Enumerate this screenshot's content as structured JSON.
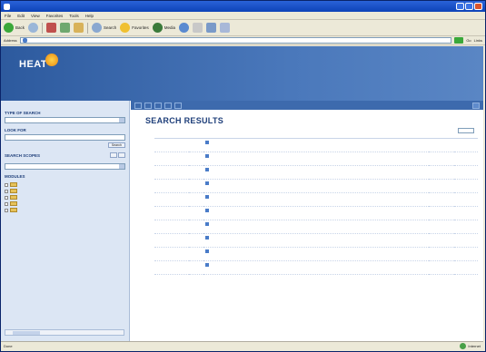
{
  "window": {
    "title": "",
    "menu": [
      "File",
      "Edit",
      "View",
      "Favorites",
      "Tools",
      "Help"
    ]
  },
  "toolbar": {
    "back_label": "Back",
    "search_label": "Search",
    "favorites_label": "Favorites",
    "media_label": "Media"
  },
  "address": {
    "label": "Address",
    "value": "",
    "go_label": "Go",
    "links_label": "Links"
  },
  "banner": {
    "logo": "HEAT",
    "subtitle": ""
  },
  "sidebar": {
    "type_label": "TYPE OF SEARCH",
    "type_value": "",
    "look_label": "LOOK FOR",
    "look_value": "",
    "search_button": "Search",
    "scope_label": "SEARCH SCOPES",
    "scope_btn_a": "",
    "scope_btn_b": "",
    "sub_label": "",
    "sub_value": "",
    "modules_label": "MODULES",
    "tree": [
      {
        "label": "",
        "selected": true
      },
      {
        "label": ""
      },
      {
        "label": ""
      },
      {
        "label": ""
      },
      {
        "label": ""
      }
    ]
  },
  "tabs": {
    "items": [
      "",
      "",
      "",
      "",
      ""
    ],
    "right": ""
  },
  "results": {
    "heading": "SEARCH RESULTS",
    "count_text": "",
    "perpage_label": "",
    "columns": {
      "id": "",
      "rank": "",
      "description": "",
      "type": "",
      "action": ""
    },
    "rows": [
      {
        "id": "",
        "rank": "",
        "desc": "",
        "action": ""
      },
      {
        "id": "",
        "rank": "",
        "desc": "",
        "action": ""
      },
      {
        "id": "",
        "rank": "",
        "desc": "",
        "action": ""
      },
      {
        "id": "",
        "rank": "",
        "desc": "",
        "action": ""
      },
      {
        "id": "",
        "rank": "",
        "desc": "",
        "action": ""
      },
      {
        "id": "",
        "rank": "",
        "desc": "",
        "action": ""
      },
      {
        "id": "",
        "rank": "",
        "desc": "",
        "action": ""
      },
      {
        "id": "",
        "rank": "",
        "desc": "",
        "action": ""
      },
      {
        "id": "",
        "rank": "",
        "desc": "",
        "action": ""
      },
      {
        "id": "",
        "rank": "",
        "desc": "",
        "action": ""
      }
    ],
    "pager": ""
  },
  "status": {
    "text": "Done",
    "zone": "Internet"
  },
  "colors": {
    "banner": "#3c6aae",
    "accent": "#1f3f7a",
    "link": "#2050a8"
  }
}
